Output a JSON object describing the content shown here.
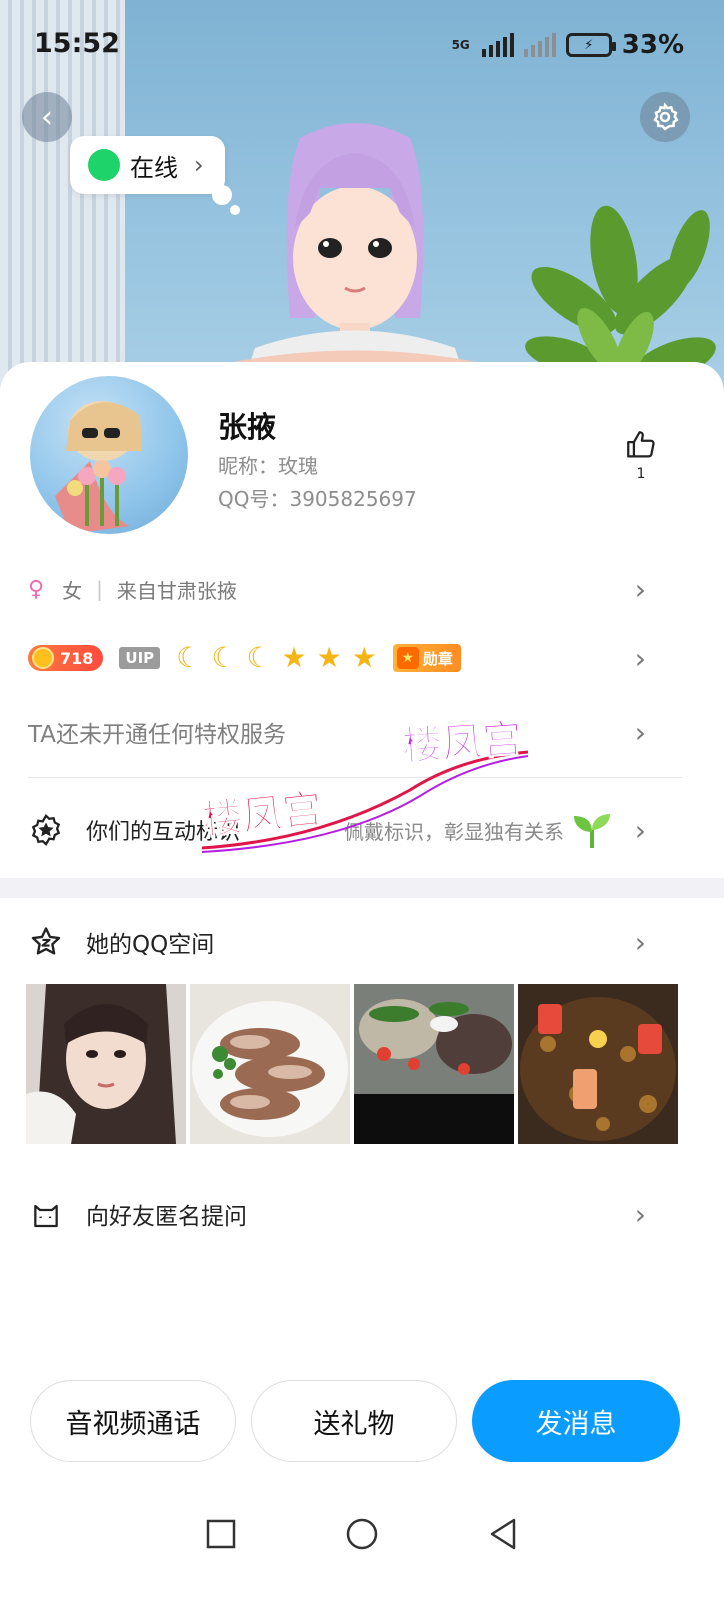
{
  "status_bar": {
    "time": "15:52",
    "network": "5G",
    "battery_percent": "33%"
  },
  "header": {
    "online_status": "在线"
  },
  "profile": {
    "name": "张掖",
    "nickname": "昵称：玫瑰",
    "qq_number": "QQ号：3905825697",
    "like_count": "1"
  },
  "info": {
    "gender": "女",
    "location": "来自甘肃张掖",
    "level": "718",
    "vip_label": "UIP",
    "badge_label": "勋章",
    "privilege_text": "TA还未开通任何特权服务"
  },
  "interaction": {
    "label": "你们的互动标识",
    "hint": "佩戴标识，彰显独有关系"
  },
  "qzone": {
    "label": "她的QQ空间"
  },
  "anonymous_ask": {
    "label": "向好友匿名提问"
  },
  "watermarks": [
    "楼凤宫",
    "楼凤宫"
  ],
  "actions": {
    "call": "音视频通话",
    "gift": "送礼物",
    "message": "发消息"
  },
  "colors": {
    "primary": "#0a9cff",
    "online": "#1fd36b",
    "female": "#f06bb2"
  }
}
